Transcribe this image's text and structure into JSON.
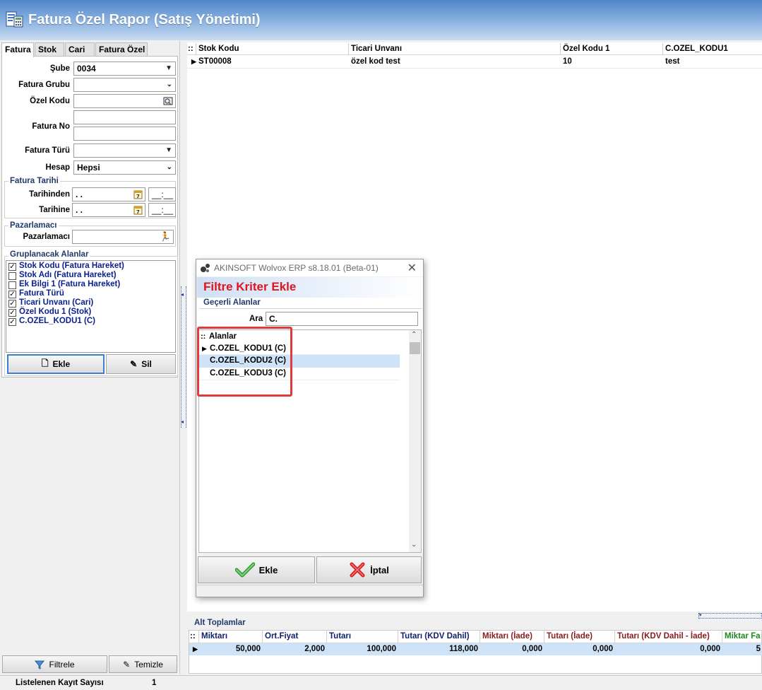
{
  "window": {
    "title": "Fatura Özel Rapor (Satış Yönetimi)"
  },
  "left_panel": {
    "tabs": [
      {
        "label": "Fatura",
        "active": true
      },
      {
        "label": "Stok",
        "active": false
      },
      {
        "label": "Cari",
        "active": false
      },
      {
        "label": "Fatura Özel",
        "active": false
      }
    ],
    "fields": {
      "sube": {
        "label": "Şube",
        "value": "0034"
      },
      "fatura_grubu": {
        "label": "Fatura Grubu",
        "value": ""
      },
      "ozel_kodu": {
        "label": "Özel Kodu",
        "value": ""
      },
      "fatura_no": {
        "label": "Fatura No",
        "value": ""
      },
      "fatura_turu": {
        "label": "Fatura Türü",
        "value": ""
      },
      "hesap": {
        "label": "Hesap",
        "value": "Hepsi"
      }
    },
    "fatura_tarihi": {
      "title": "Fatura Tarihi",
      "from_label": "Tarihinden",
      "from_date": " .  .",
      "from_time": "__:__",
      "to_label": "Tarihine",
      "to_date": " .  .",
      "to_time": "__:__"
    },
    "pazarlamaci": {
      "title": "Pazarlamacı",
      "label": "Pazarlamacı",
      "value": ""
    },
    "grouping": {
      "title": "Gruplanacak Alanlar",
      "items": [
        {
          "label": "Stok Kodu  (Fatura Hareket)",
          "checked": true
        },
        {
          "label": "Stok Adı  (Fatura Hareket)",
          "checked": false
        },
        {
          "label": "Ek Bilgi 1 (Fatura Hareket)",
          "checked": false
        },
        {
          "label": "Fatura Türü",
          "checked": true
        },
        {
          "label": "Ticari Unvanı  (Cari)",
          "checked": true
        },
        {
          "label": "Özel Kodu 1  (Stok)",
          "checked": true
        },
        {
          "label": "C.OZEL_KODU1 (C)",
          "checked": true
        }
      ],
      "add_label": "Ekle",
      "delete_label": "Sil"
    },
    "filter_label": "Filtrele",
    "clear_label": "Temizle"
  },
  "grid": {
    "marker": "::",
    "columns": [
      "Stok Kodu",
      "Ticari Unvanı",
      "Özel Kodu 1",
      "C.OZEL_KODU1"
    ],
    "rows": [
      [
        "ST00008",
        "özel kod test",
        "10",
        "test"
      ]
    ]
  },
  "totals": {
    "title": "Alt Toplamlar",
    "marker": "::",
    "columns": [
      {
        "label": "Miktarı",
        "color": "#0d1f6b"
      },
      {
        "label": "Ort.Fiyat",
        "color": "#0d1f6b"
      },
      {
        "label": "Tutarı",
        "color": "#0d1f6b"
      },
      {
        "label": "Tutarı (KDV Dahil)",
        "color": "#0d1f6b"
      },
      {
        "label": "Miktarı (İade)",
        "color": "#8b1a1a"
      },
      {
        "label": "Tutarı (İade)",
        "color": "#8b1a1a"
      },
      {
        "label": "Tutarı (KDV Dahil - İade)",
        "color": "#8b1a1a"
      },
      {
        "label": "Miktar Fa",
        "color": "#1a8a1a"
      }
    ],
    "values": [
      "50,000",
      "2,000",
      "100,000",
      "118,000",
      "0,000",
      "0,000",
      "0,000",
      "5"
    ]
  },
  "status": {
    "label": "Listelenen Kayıt Sayısı",
    "value": "1"
  },
  "dialog": {
    "title": "AKINSOFT Wolvox ERP s8.18.01 (Beta-01)",
    "header": "Filtre Kriter Ekle",
    "section": "Geçerli Alanlar",
    "search_label": "Ara",
    "search_value": "C.",
    "list_header": "Alanlar",
    "list_marker": "::",
    "items": [
      "C.OZEL_KODU1 (C)",
      "C.OZEL_KODU2 (C)",
      "C.OZEL_KODU3 (C)"
    ],
    "ok_label": "Ekle",
    "cancel_label": "İptal",
    "highlight_color": "#e03a3a",
    "header_color": "#e0141e"
  },
  "colors": {
    "accent": "#4f86c9",
    "selection": "#cfe3f8",
    "highlight_border": "#e03a3a"
  }
}
